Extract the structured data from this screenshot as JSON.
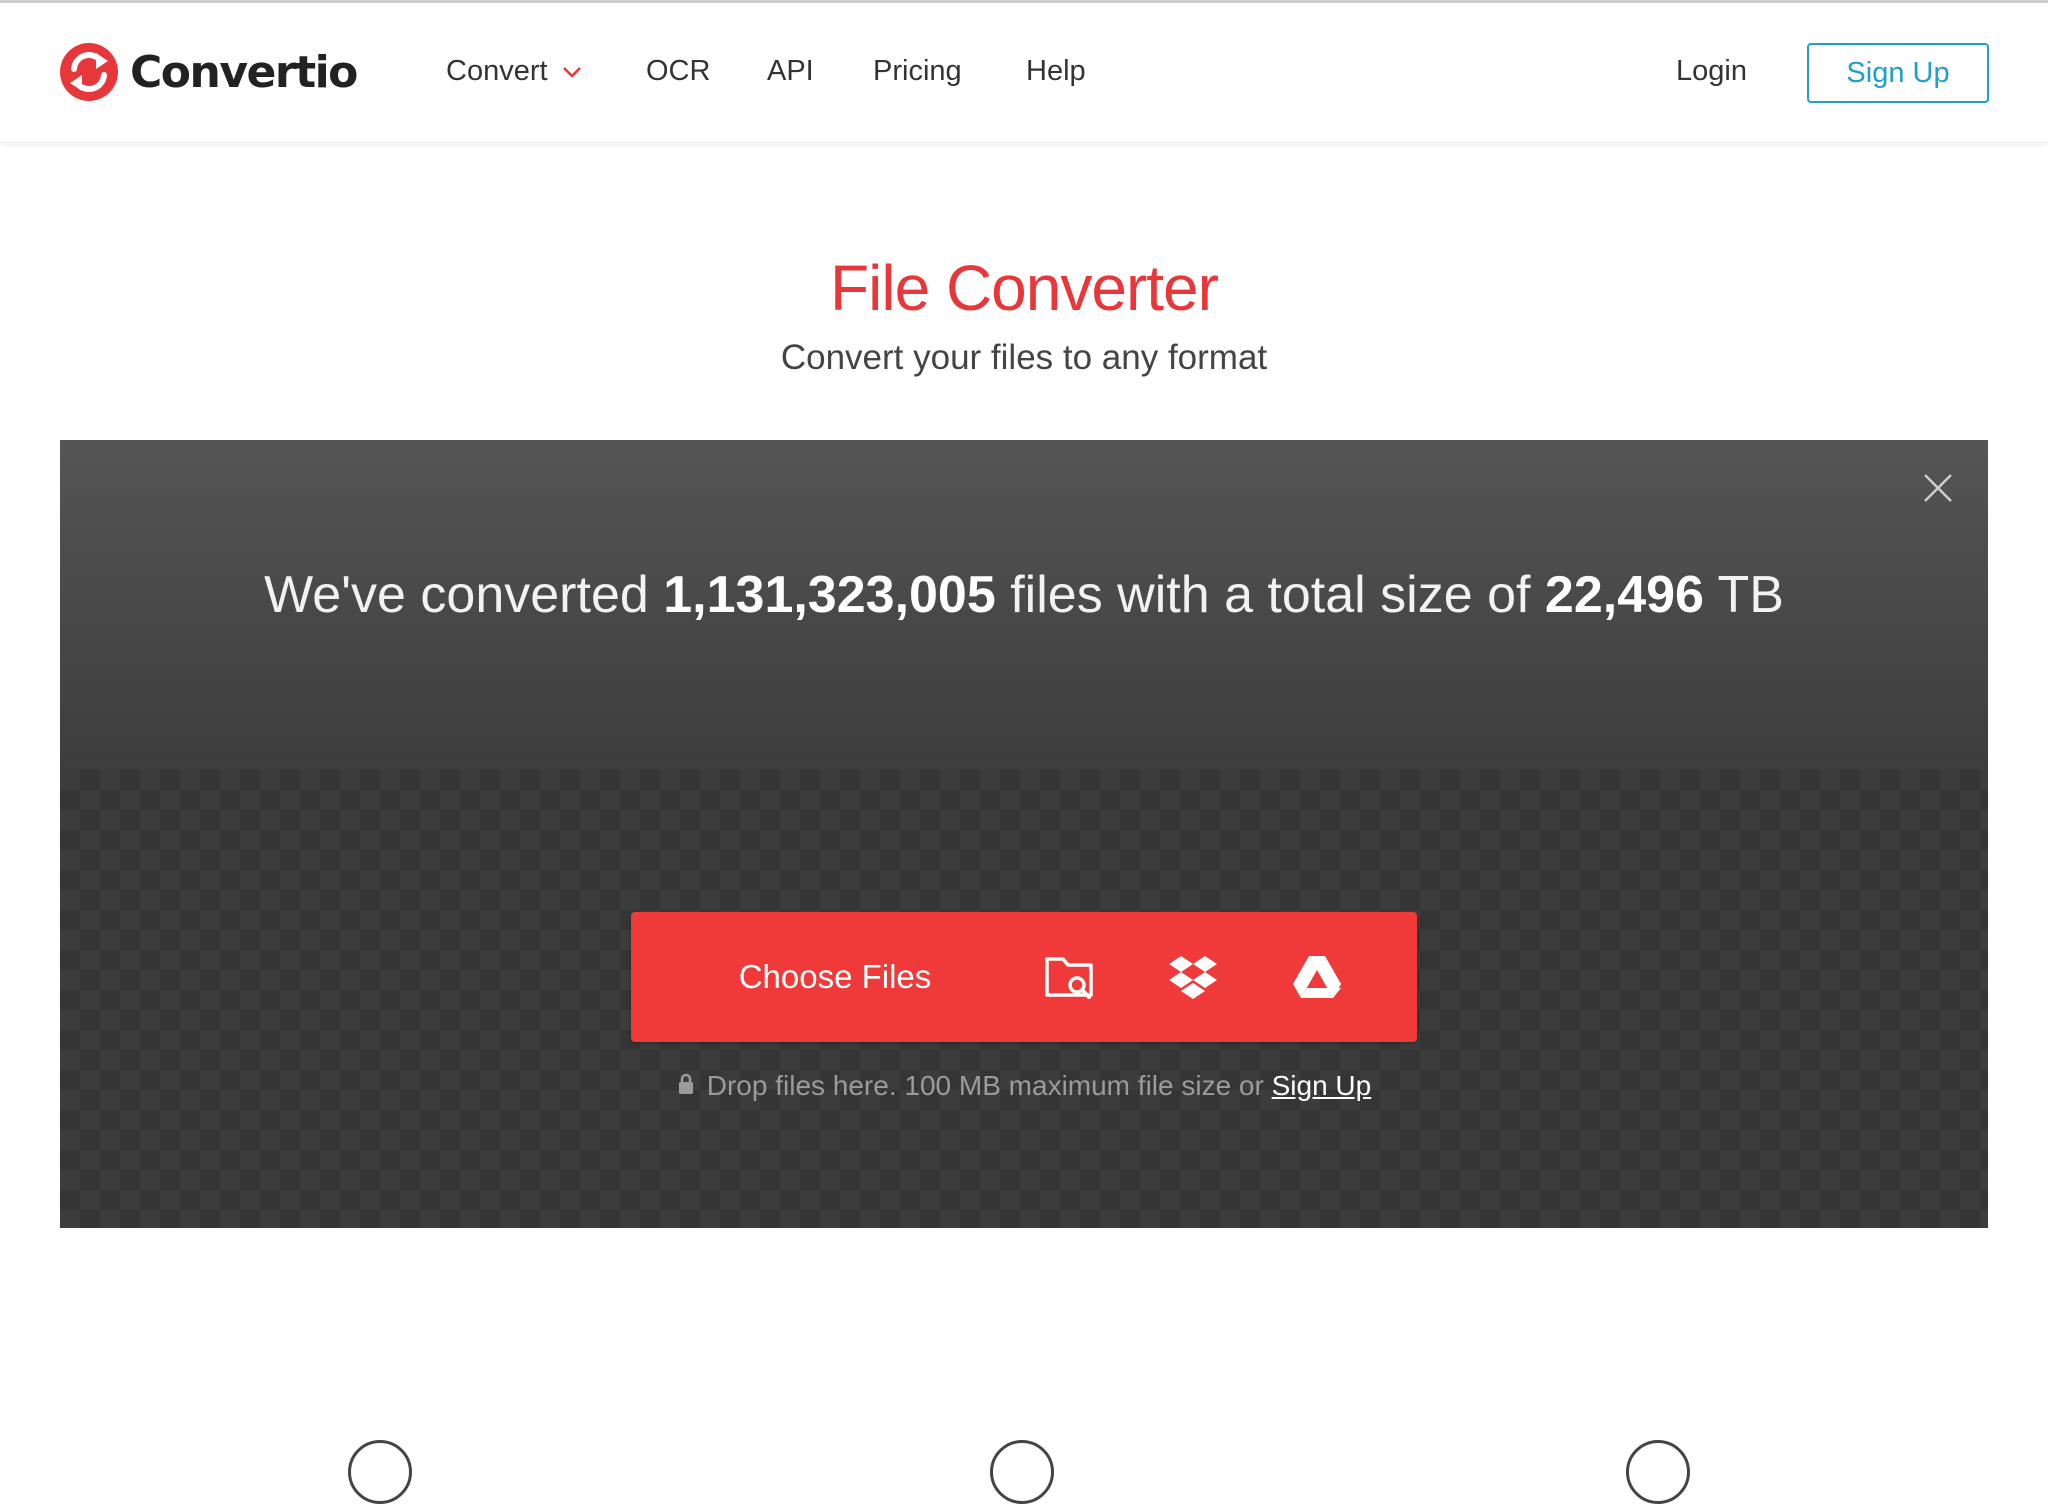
{
  "brand": {
    "name": "Convertio",
    "logo_color": "#e8373b"
  },
  "nav": {
    "items": [
      {
        "label": "Convert",
        "has_dropdown": true
      },
      {
        "label": "OCR"
      },
      {
        "label": "API"
      },
      {
        "label": "Pricing"
      },
      {
        "label": "Help"
      }
    ],
    "login_label": "Login",
    "signup_label": "Sign Up"
  },
  "hero": {
    "title": "File Converter",
    "subtitle": "Convert your files to any format"
  },
  "stats": {
    "prefix": "We've converted ",
    "files_count": "1,131,323,005",
    "middle": " files with a total size of ",
    "total_size": "22,496",
    "unit": " TB"
  },
  "upload": {
    "choose_label": "Choose Files",
    "sources": [
      "folder-search-icon",
      "dropbox-icon",
      "google-drive-icon"
    ],
    "drop_note": "Drop files here. 100 MB maximum file size or ",
    "signup_link": "Sign Up"
  },
  "colors": {
    "accent": "#e8373b",
    "button": "#f03a3a",
    "signup_outline": "#20a0c8",
    "panel": "#3a3a3a"
  }
}
